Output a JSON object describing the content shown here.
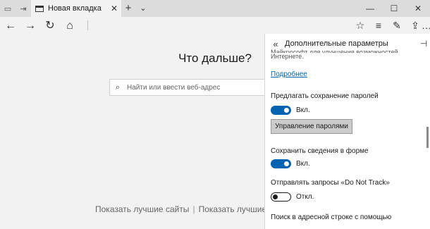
{
  "tabs": {
    "active_title": "Новая вкладка",
    "close_glyph": "✕",
    "add_glyph": "+",
    "list_glyph": "⌄"
  },
  "window_controls": {
    "minimize": "—",
    "maximize": "☐",
    "close": "✕"
  },
  "nav": {
    "back_glyph": "←",
    "forward_glyph": "→",
    "refresh_glyph": "↻",
    "home_glyph": "⌂"
  },
  "toolbar": {
    "favorites_glyph": "☆",
    "hub_glyph": "≡",
    "notes_glyph": "✎",
    "share_glyph": "⇪",
    "more_glyph": "…"
  },
  "main": {
    "heading": "Что дальше?",
    "search_placeholder": "Найти или ввести веб-адрес",
    "bottom_link_1": "Показать лучшие сайты",
    "bottom_sep": "|",
    "bottom_link_2": "Показать лучшие с"
  },
  "panel": {
    "back_glyph": "«",
    "title": "Дополнительные параметры",
    "pin_glyph": "⊣",
    "partial_line_1": "Майкрософт для улучшения возможностей работы в",
    "partial_line_2": "Интернете.",
    "learn_more": "Подробнее",
    "save_passwords_label": "Предлагать сохранение паролей",
    "save_passwords_state": "Вкл.",
    "save_passwords_on": true,
    "manage_passwords_button": "Управление паролями",
    "save_form_label": "Сохранить сведения в форме",
    "save_form_state": "Вкл.",
    "save_form_on": true,
    "dnt_label": "Отправлять запросы «Do Not Track»",
    "dnt_state": "Откл.",
    "dnt_on": false,
    "address_bar_search_label": "Поиск в адресной строке с помощью"
  },
  "colors": {
    "accent": "#0063b1",
    "chrome": "#f2f2f2",
    "tab_strip": "#dcdcdc"
  }
}
